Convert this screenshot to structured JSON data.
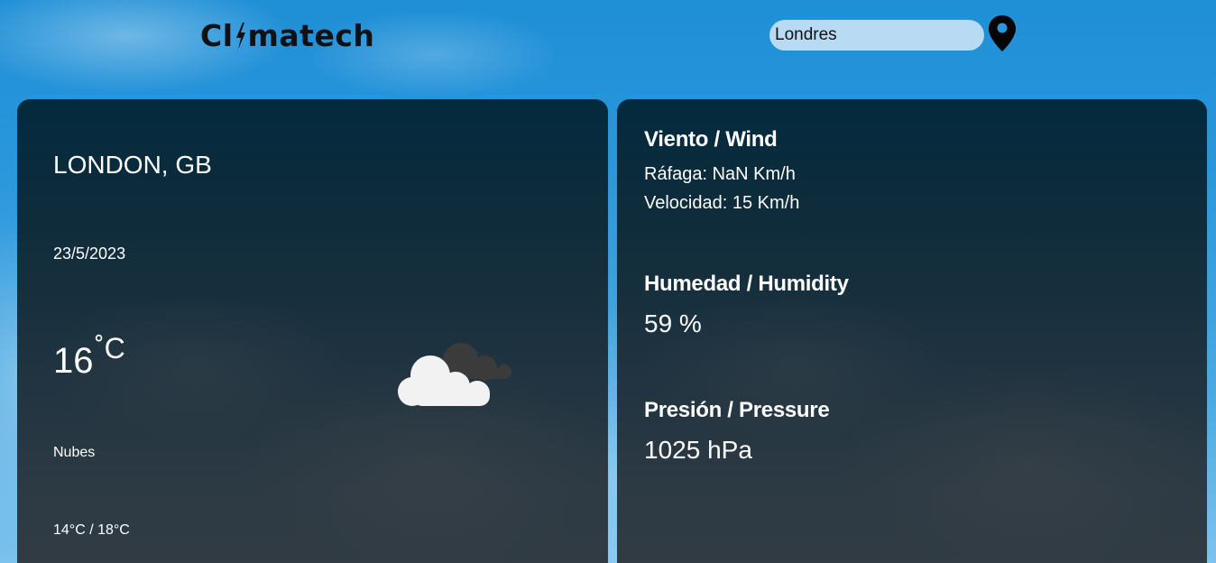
{
  "header": {
    "logo_part1": "Cl",
    "logo_part2": "matech",
    "search_value": "Londres",
    "icons": {
      "location": "map-pin-icon",
      "logo_bolt": "lightning-bolt-icon"
    }
  },
  "current": {
    "city": "LONDON, GB",
    "date": "23/5/2023",
    "temperature": "16",
    "unit": "˚C",
    "description": "Nubes",
    "range": "14°C / 18°C",
    "icon": "cloud-icon"
  },
  "details": {
    "wind_title": "Viento / Wind",
    "gust": "Ráfaga: NaN Km/h",
    "speed": "Velocidad: 15 Km/h",
    "humidity_title": "Humedad / Humidity",
    "humidity_value": "59 %",
    "pressure_title": "Presión / Pressure",
    "pressure_value": "1025 hPa"
  },
  "colors": {
    "card_bg": "#0f2c3b",
    "search_bg": "#b8dbf3",
    "logo": "#0d1216",
    "sky": "#2a97dc"
  }
}
